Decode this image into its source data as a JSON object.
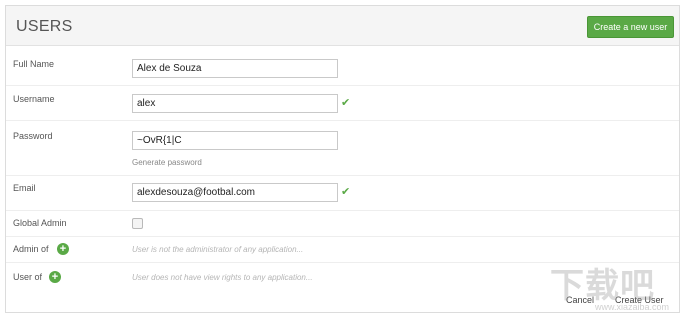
{
  "header": {
    "title": "USERS",
    "create_button_label": "Create a new user"
  },
  "form": {
    "full_name": {
      "label": "Full Name",
      "value": "Alex de Souza"
    },
    "username": {
      "label": "Username",
      "value": "alex",
      "valid_icon": "check-icon"
    },
    "password": {
      "label": "Password",
      "value": "~OvR{1|C",
      "helper": "Generate password"
    },
    "email": {
      "label": "Email",
      "value": "alexdesouza@footbal.com",
      "valid_icon": "check-icon"
    },
    "global_admin": {
      "label": "Global Admin",
      "checked": false
    },
    "admin_of": {
      "label": "Admin of",
      "empty_text": "User is not the administrator of any application..."
    },
    "user_of": {
      "label": "User of",
      "empty_text": "User does not have view rights to any application..."
    }
  },
  "footer": {
    "cancel_label": "Cancel",
    "create_label": "Create User"
  },
  "colors": {
    "accent": "#5aa946",
    "header_bg": "#f5f5f5"
  }
}
